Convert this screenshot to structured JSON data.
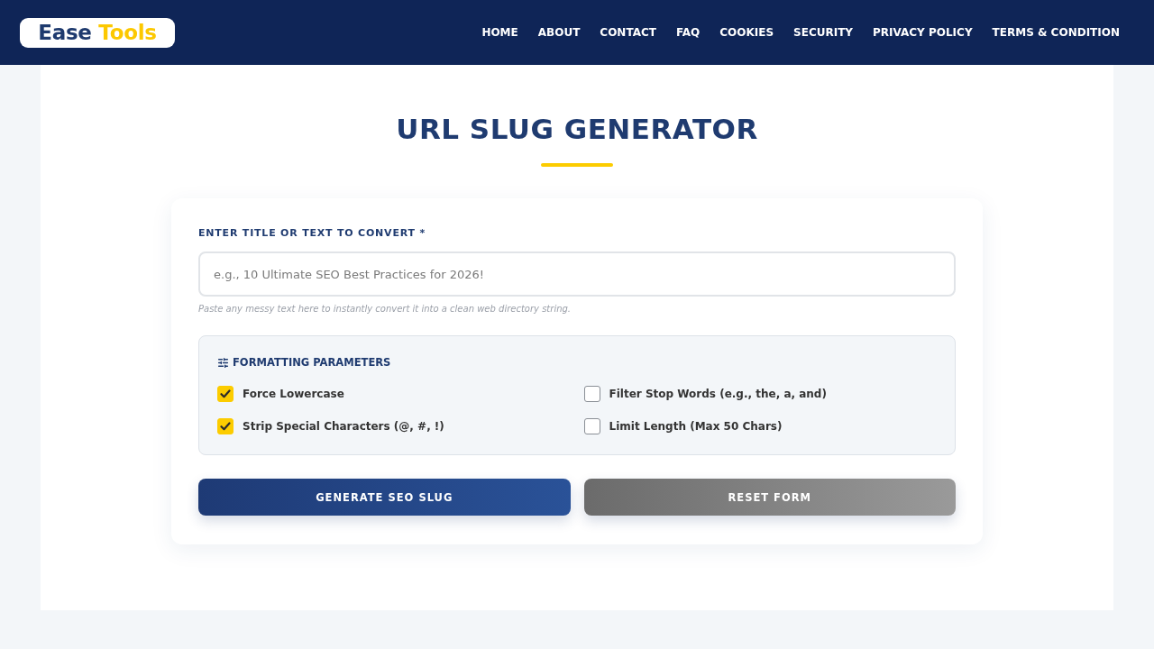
{
  "header": {
    "logo": {
      "part_1": "Ease",
      "part_2": "Tools"
    },
    "nav": [
      "HOME",
      "ABOUT",
      "CONTACT",
      "FAQ",
      "COOKIES",
      "SECURITY",
      "PRIVACY POLICY",
      "TERMS & CONDITION"
    ]
  },
  "page": {
    "title": "URL SLUG GENERATOR"
  },
  "form": {
    "label": "ENTER TITLE OR TEXT TO CONVERT *",
    "input": {
      "placeholder": "e.g., 10 Ultimate SEO Best Practices for 2026!"
    },
    "hint": "Paste any messy text here to instantly convert it into a clean web directory string.",
    "parameters": {
      "title": "FORMATTING PARAMETERS",
      "options": [
        {
          "label": "Force Lowercase",
          "checked": true
        },
        {
          "label": "Filter Stop Words (e.g., the, a, and)",
          "checked": false
        },
        {
          "label": "Strip Special Characters (@, #, !)",
          "checked": true
        },
        {
          "label": "Limit Length (Max 50 Chars)",
          "checked": false
        }
      ]
    },
    "buttons": [
      {
        "label": "GENERATE SEO SLUG",
        "kind": "primary"
      },
      {
        "label": "RESET FORM",
        "kind": "secondary"
      }
    ]
  }
}
